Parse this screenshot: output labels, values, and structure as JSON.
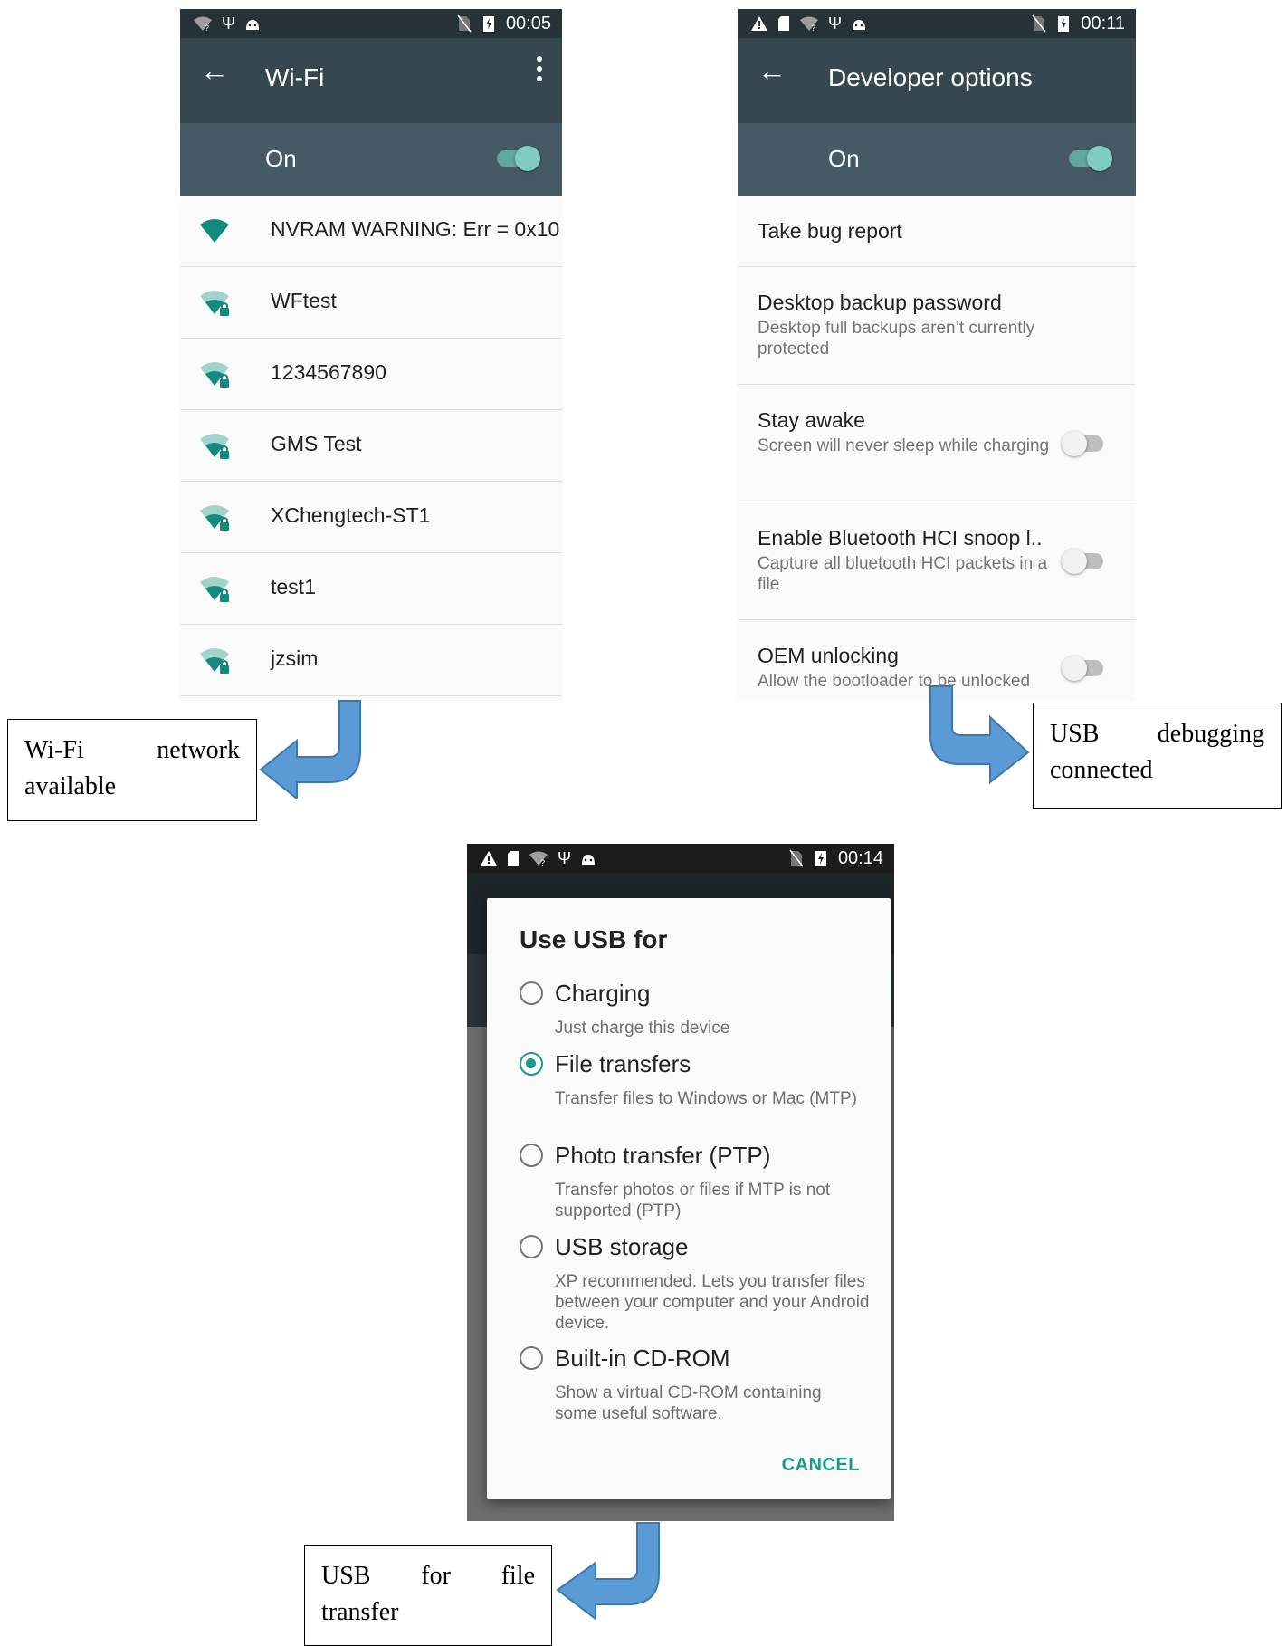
{
  "wifi_screen": {
    "status_time": "00:05",
    "title": "Wi-Fi",
    "master_label": "On",
    "networks": [
      {
        "name": "NVRAM WARNING: Err = 0x10",
        "locked": false
      },
      {
        "name": "WFtest",
        "locked": true
      },
      {
        "name": "1234567890",
        "locked": true
      },
      {
        "name": "GMS Test",
        "locked": true
      },
      {
        "name": "XChengtech-ST1",
        "locked": true
      },
      {
        "name": "test1",
        "locked": true
      },
      {
        "name": "jzsim",
        "locked": true
      }
    ]
  },
  "developer_screen": {
    "status_time": "00:11",
    "title": "Developer options",
    "master_label": "On",
    "items": [
      {
        "title": "Take bug report",
        "summary": ""
      },
      {
        "title": "Desktop backup password",
        "summary": "Desktop full backups aren’t currently protected"
      },
      {
        "title": "Stay awake",
        "summary": "Screen will never sleep while charging",
        "toggle": "off"
      },
      {
        "title": "Enable Bluetooth HCI snoop l..",
        "summary": "Capture all bluetooth HCI packets in a file",
        "toggle": "off"
      },
      {
        "title": "OEM unlocking",
        "summary": "Allow the bootloader to be unlocked",
        "toggle": "off"
      }
    ]
  },
  "usb_screen": {
    "status_time": "00:14",
    "dialog_title": "Use USB for",
    "options": [
      {
        "label": "Charging",
        "desc": "Just charge this device",
        "selected": false
      },
      {
        "label": "File transfers",
        "desc": "Transfer files to Windows or Mac (MTP)",
        "selected": true
      },
      {
        "label": "Photo transfer (PTP)",
        "desc": "Transfer photos or files if MTP is not supported (PTP)",
        "selected": false
      },
      {
        "label": "USB storage",
        "desc": "XP recommended. Lets you transfer files between your computer and your Android device.",
        "selected": false
      },
      {
        "label": "Built-in CD-ROM",
        "desc": "Show a virtual CD-ROM containing some useful software.",
        "selected": false
      }
    ],
    "cancel_label": "CANCEL"
  },
  "callouts": {
    "wifi": {
      "w1": "Wi-Fi",
      "w2": "network",
      "line2": "available"
    },
    "usb_debug": {
      "w1": "USB",
      "w2": "debugging",
      "line2": "connected"
    },
    "usb_file": {
      "w1": "USB",
      "w2": "for",
      "w3": "file",
      "line2": "transfer"
    }
  },
  "colors": {
    "status_bar": "#263238",
    "app_bar": "#37474f",
    "master_bar": "#455a64",
    "accent_teal": "#1a9a8a",
    "wifi_icon": "#148a7e",
    "arrow_blue": "#5b9bd5"
  },
  "icons": [
    "wifi-signal-icon",
    "usb-icon",
    "android-debug-icon",
    "no-sim-icon",
    "battery-charging-icon",
    "warning-icon",
    "sd-card-icon",
    "back-arrow-icon",
    "overflow-menu-icon",
    "wifi-lock-icon"
  ]
}
